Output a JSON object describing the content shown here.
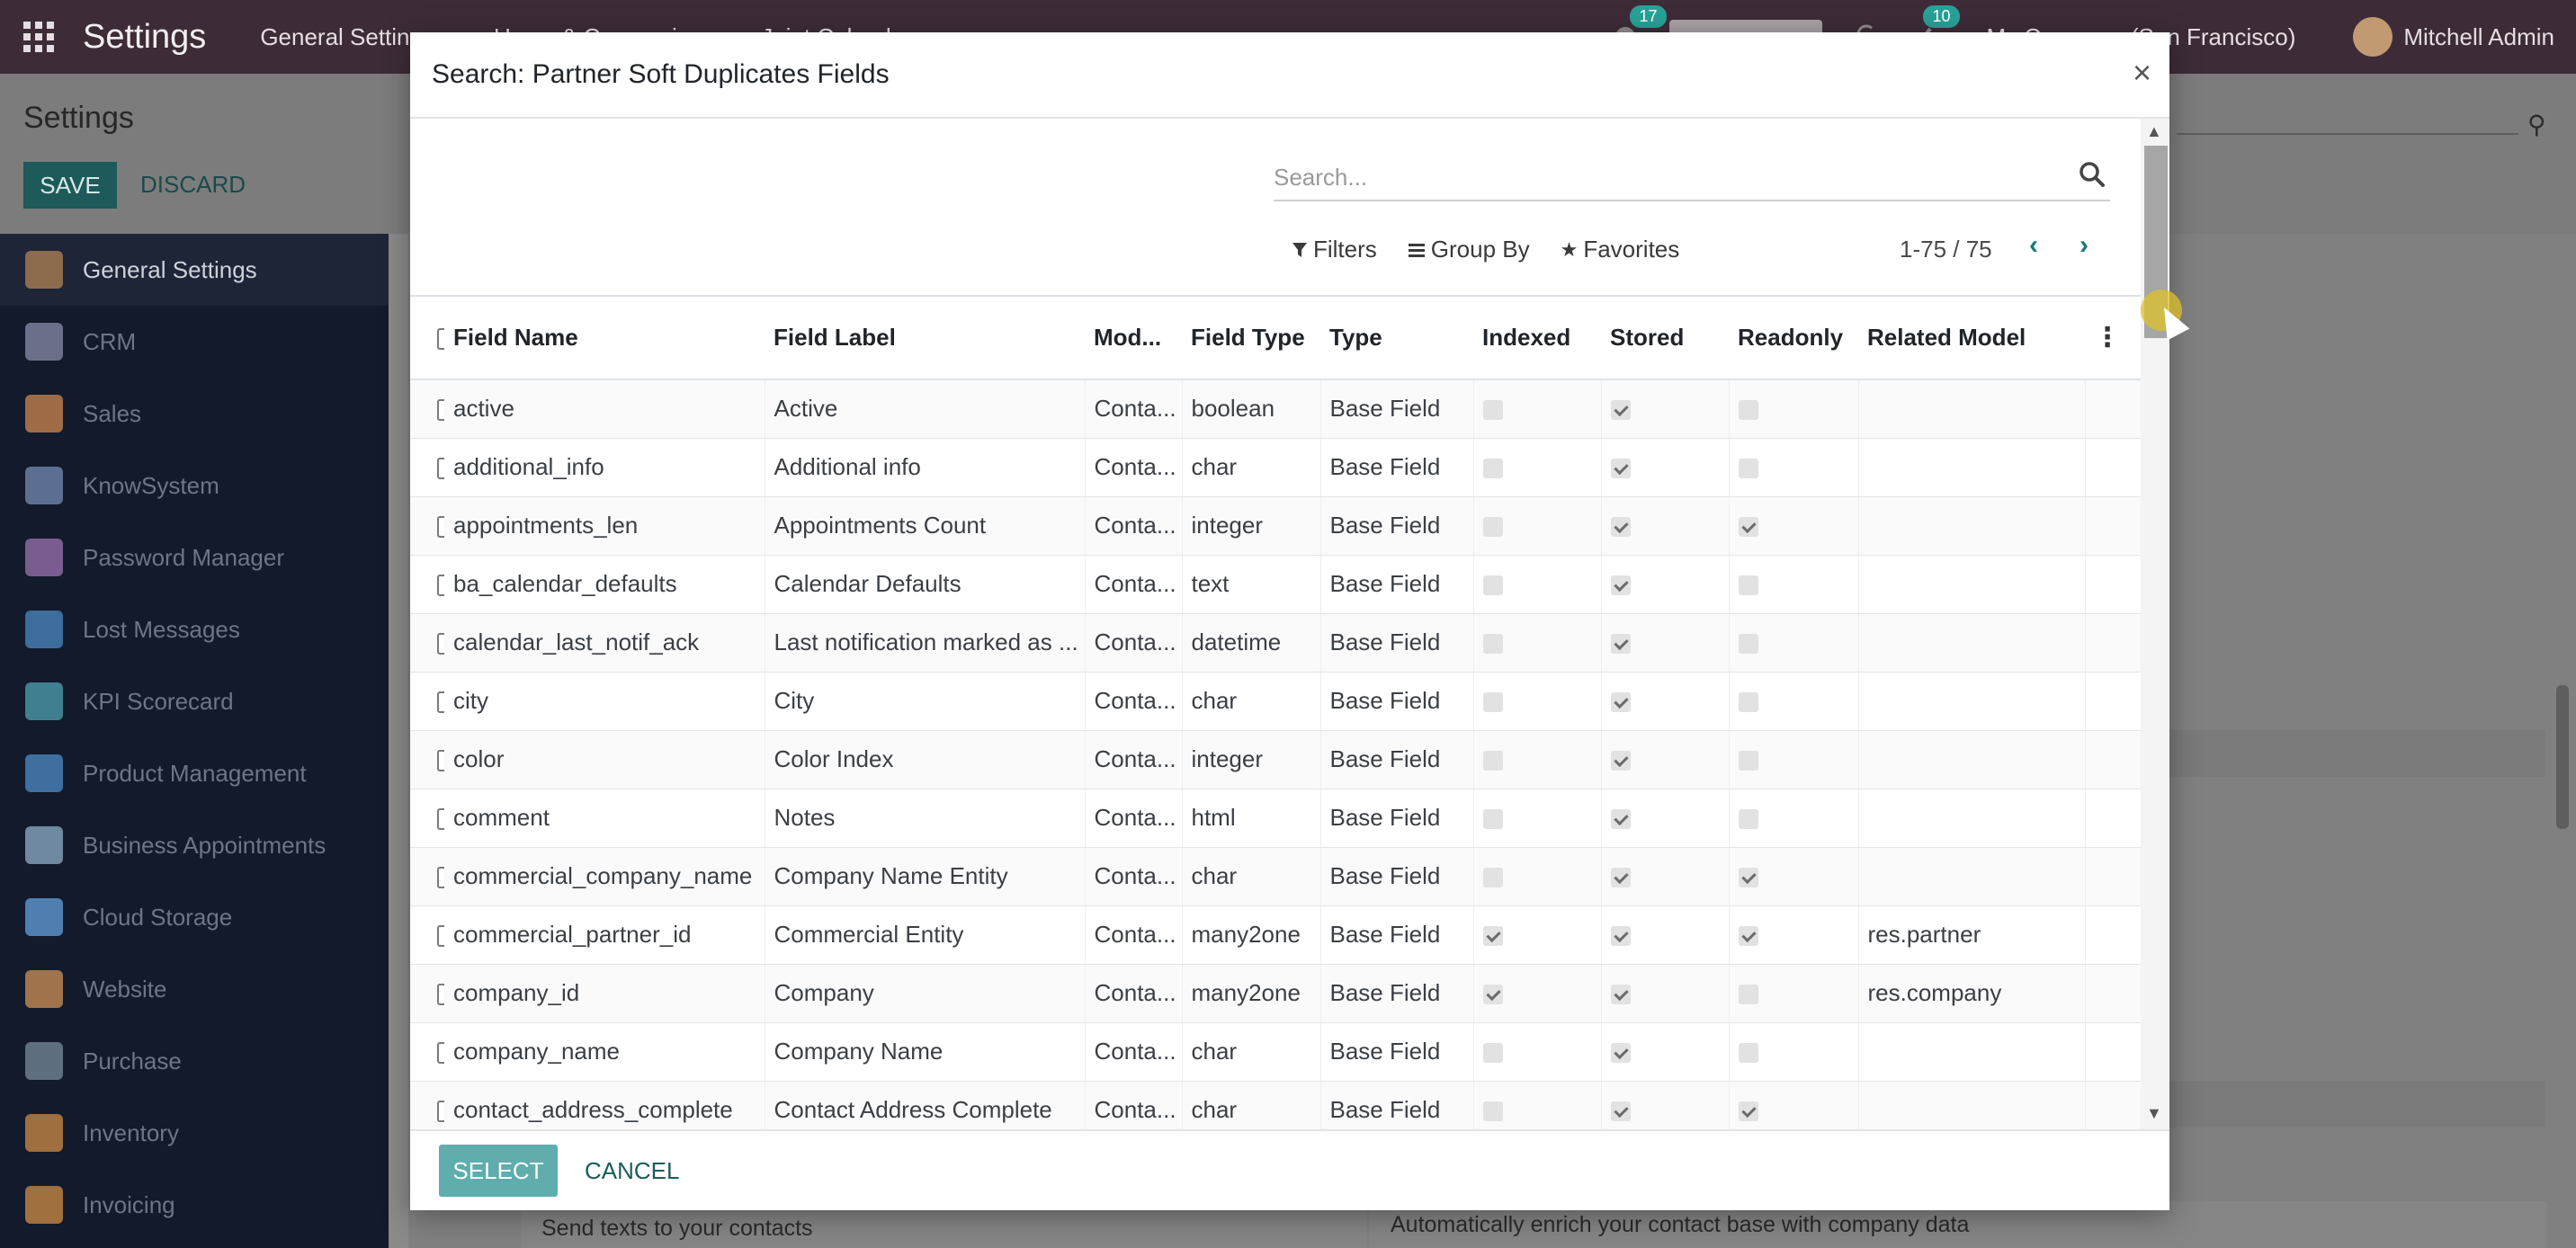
{
  "topbar": {
    "app_title": "Settings",
    "menus": [
      "General Settings",
      "Users & Companies",
      "Joint Calendars"
    ],
    "badge_messages": "17",
    "badge_activities": "10",
    "company": "My Company (San Francisco)",
    "user": "Mitchell Admin"
  },
  "control_panel": {
    "title": "Settings",
    "save_label": "SAVE",
    "discard_label": "DISCARD"
  },
  "sidebar": {
    "items": [
      {
        "label": "General Settings",
        "color": "#8d6b4e"
      },
      {
        "label": "CRM",
        "color": "#6b6f8a"
      },
      {
        "label": "Sales",
        "color": "#a06c46"
      },
      {
        "label": "KnowSystem",
        "color": "#5d6f91"
      },
      {
        "label": "Password Manager",
        "color": "#7b5c8f"
      },
      {
        "label": "Lost Messages",
        "color": "#3d6d9a"
      },
      {
        "label": "KPI Scorecard",
        "color": "#3f7f8f"
      },
      {
        "label": "Product Management",
        "color": "#3f6f9f"
      },
      {
        "label": "Business Appointments",
        "color": "#6f8aa0"
      },
      {
        "label": "Cloud Storage",
        "color": "#4f7fb0"
      },
      {
        "label": "Website",
        "color": "#a0734d"
      },
      {
        "label": "Purchase",
        "color": "#5f6f7f"
      },
      {
        "label": "Inventory",
        "color": "#a06f3f"
      },
      {
        "label": "Invoicing",
        "color": "#a0703f"
      }
    ]
  },
  "background_cards": {
    "left_text": "Send texts to your contacts",
    "right_text": "Automatically enrich your contact base with company data"
  },
  "modal": {
    "title": "Search: Partner Soft Duplicates Fields",
    "search_placeholder": "Search...",
    "filters_label": "Filters",
    "group_by_label": "Group By",
    "favorites_label": "Favorites",
    "pager": "1-75 / 75",
    "columns": [
      "Field Name",
      "Field Label",
      "Mod...",
      "Field Type",
      "Type",
      "Indexed",
      "Stored",
      "Readonly",
      "Related Model"
    ],
    "rows": [
      {
        "name": "active",
        "label": "Active",
        "model": "Conta...",
        "ftype": "boolean",
        "type": "Base Field",
        "indexed": false,
        "stored": true,
        "readonly": false,
        "related": ""
      },
      {
        "name": "additional_info",
        "label": "Additional info",
        "model": "Conta...",
        "ftype": "char",
        "type": "Base Field",
        "indexed": false,
        "stored": true,
        "readonly": false,
        "related": ""
      },
      {
        "name": "appointments_len",
        "label": "Appointments Count",
        "model": "Conta...",
        "ftype": "integer",
        "type": "Base Field",
        "indexed": false,
        "stored": true,
        "readonly": true,
        "related": ""
      },
      {
        "name": "ba_calendar_defaults",
        "label": "Calendar Defaults",
        "model": "Conta...",
        "ftype": "text",
        "type": "Base Field",
        "indexed": false,
        "stored": true,
        "readonly": false,
        "related": ""
      },
      {
        "name": "calendar_last_notif_ack",
        "label": "Last notification marked as ...",
        "model": "Conta...",
        "ftype": "datetime",
        "type": "Base Field",
        "indexed": false,
        "stored": true,
        "readonly": false,
        "related": ""
      },
      {
        "name": "city",
        "label": "City",
        "model": "Conta...",
        "ftype": "char",
        "type": "Base Field",
        "indexed": false,
        "stored": true,
        "readonly": false,
        "related": ""
      },
      {
        "name": "color",
        "label": "Color Index",
        "model": "Conta...",
        "ftype": "integer",
        "type": "Base Field",
        "indexed": false,
        "stored": true,
        "readonly": false,
        "related": ""
      },
      {
        "name": "comment",
        "label": "Notes",
        "model": "Conta...",
        "ftype": "html",
        "type": "Base Field",
        "indexed": false,
        "stored": true,
        "readonly": false,
        "related": ""
      },
      {
        "name": "commercial_company_name",
        "label": "Company Name Entity",
        "model": "Conta...",
        "ftype": "char",
        "type": "Base Field",
        "indexed": false,
        "stored": true,
        "readonly": true,
        "related": ""
      },
      {
        "name": "commercial_partner_id",
        "label": "Commercial Entity",
        "model": "Conta...",
        "ftype": "many2one",
        "type": "Base Field",
        "indexed": true,
        "stored": true,
        "readonly": true,
        "related": "res.partner"
      },
      {
        "name": "company_id",
        "label": "Company",
        "model": "Conta...",
        "ftype": "many2one",
        "type": "Base Field",
        "indexed": true,
        "stored": true,
        "readonly": false,
        "related": "res.company"
      },
      {
        "name": "company_name",
        "label": "Company Name",
        "model": "Conta...",
        "ftype": "char",
        "type": "Base Field",
        "indexed": false,
        "stored": true,
        "readonly": false,
        "related": ""
      },
      {
        "name": "contact_address_complete",
        "label": "Contact Address Complete",
        "model": "Conta...",
        "ftype": "char",
        "type": "Base Field",
        "indexed": false,
        "stored": true,
        "readonly": true,
        "related": ""
      }
    ],
    "select_label": "SELECT",
    "cancel_label": "CANCEL"
  }
}
